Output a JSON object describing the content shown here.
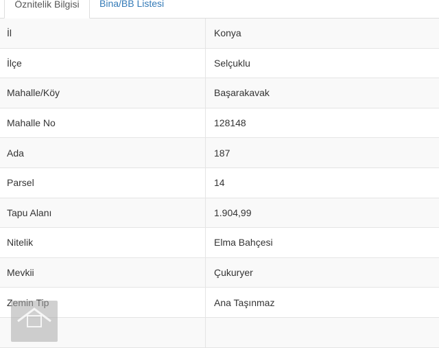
{
  "tabs": [
    {
      "label": "Öznitelik Bilgisi",
      "active": true
    },
    {
      "label": "Bina/BB Listesi",
      "active": false
    }
  ],
  "rows": [
    {
      "label": "İl",
      "value": "Konya"
    },
    {
      "label": "İlçe",
      "value": "Selçuklu"
    },
    {
      "label": "Mahalle/Köy",
      "value": "Başarakavak"
    },
    {
      "label": "Mahalle No",
      "value": "128148"
    },
    {
      "label": "Ada",
      "value": "187"
    },
    {
      "label": "Parsel",
      "value": "14"
    },
    {
      "label": "Tapu Alanı",
      "value": "1.904,99"
    },
    {
      "label": "Nitelik",
      "value": "Elma Bahçesi"
    },
    {
      "label": "Mevkii",
      "value": "Çukuryer"
    },
    {
      "label": "Zemin Tip",
      "value": "Ana Taşınmaz"
    },
    {
      "label": "",
      "value": ""
    }
  ],
  "colors": {
    "tab_link": "#337ab7",
    "stripe": "#f9f9f9",
    "border": "#e4e4e4"
  }
}
